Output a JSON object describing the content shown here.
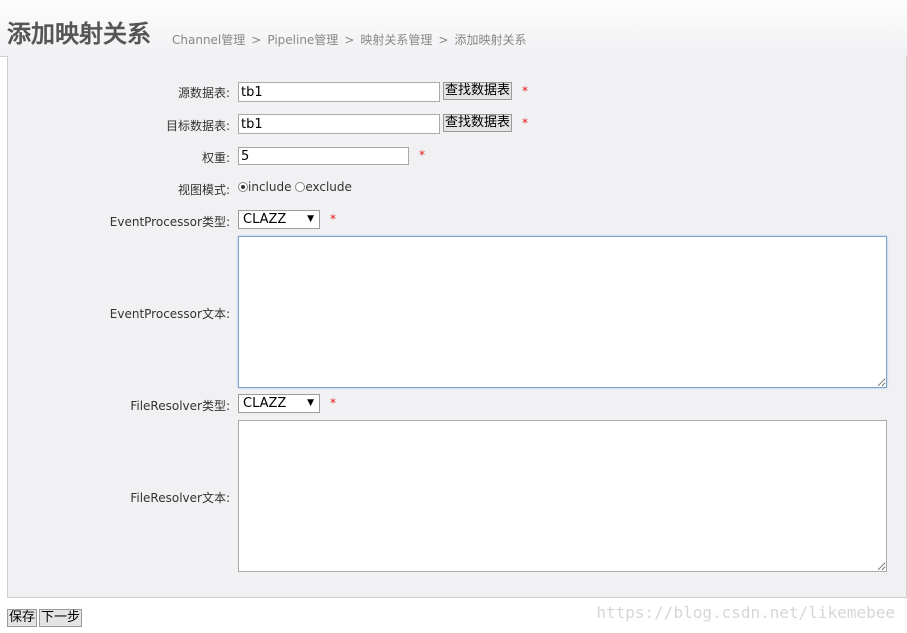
{
  "header": {
    "title": "添加映射关系",
    "breadcrumb": [
      "Channel管理",
      "Pipeline管理",
      "映射关系管理",
      "添加映射关系"
    ],
    "separator": ">"
  },
  "form": {
    "source_table": {
      "label": "源数据表:",
      "value": "tb1",
      "button": "查找数据表",
      "required": "*"
    },
    "target_table": {
      "label": "目标数据表:",
      "value": "tb1",
      "button": "查找数据表",
      "required": "*"
    },
    "weight": {
      "label": "权重:",
      "value": "5",
      "required": "*"
    },
    "view_mode": {
      "label": "视图模式:",
      "options": [
        "include",
        "exclude"
      ],
      "selected": "include"
    },
    "event_processor_type": {
      "label": "EventProcessor类型:",
      "value": "CLAZZ",
      "required": "*"
    },
    "event_processor_text": {
      "label": "EventProcessor文本:",
      "value": ""
    },
    "file_resolver_type": {
      "label": "FileResolver类型:",
      "value": "CLAZZ",
      "required": "*"
    },
    "file_resolver_text": {
      "label": "FileResolver文本:",
      "value": ""
    }
  },
  "footer": {
    "save_label": "保存",
    "next_label": "下一步"
  },
  "watermark": "https://blog.csdn.net/likemebee"
}
